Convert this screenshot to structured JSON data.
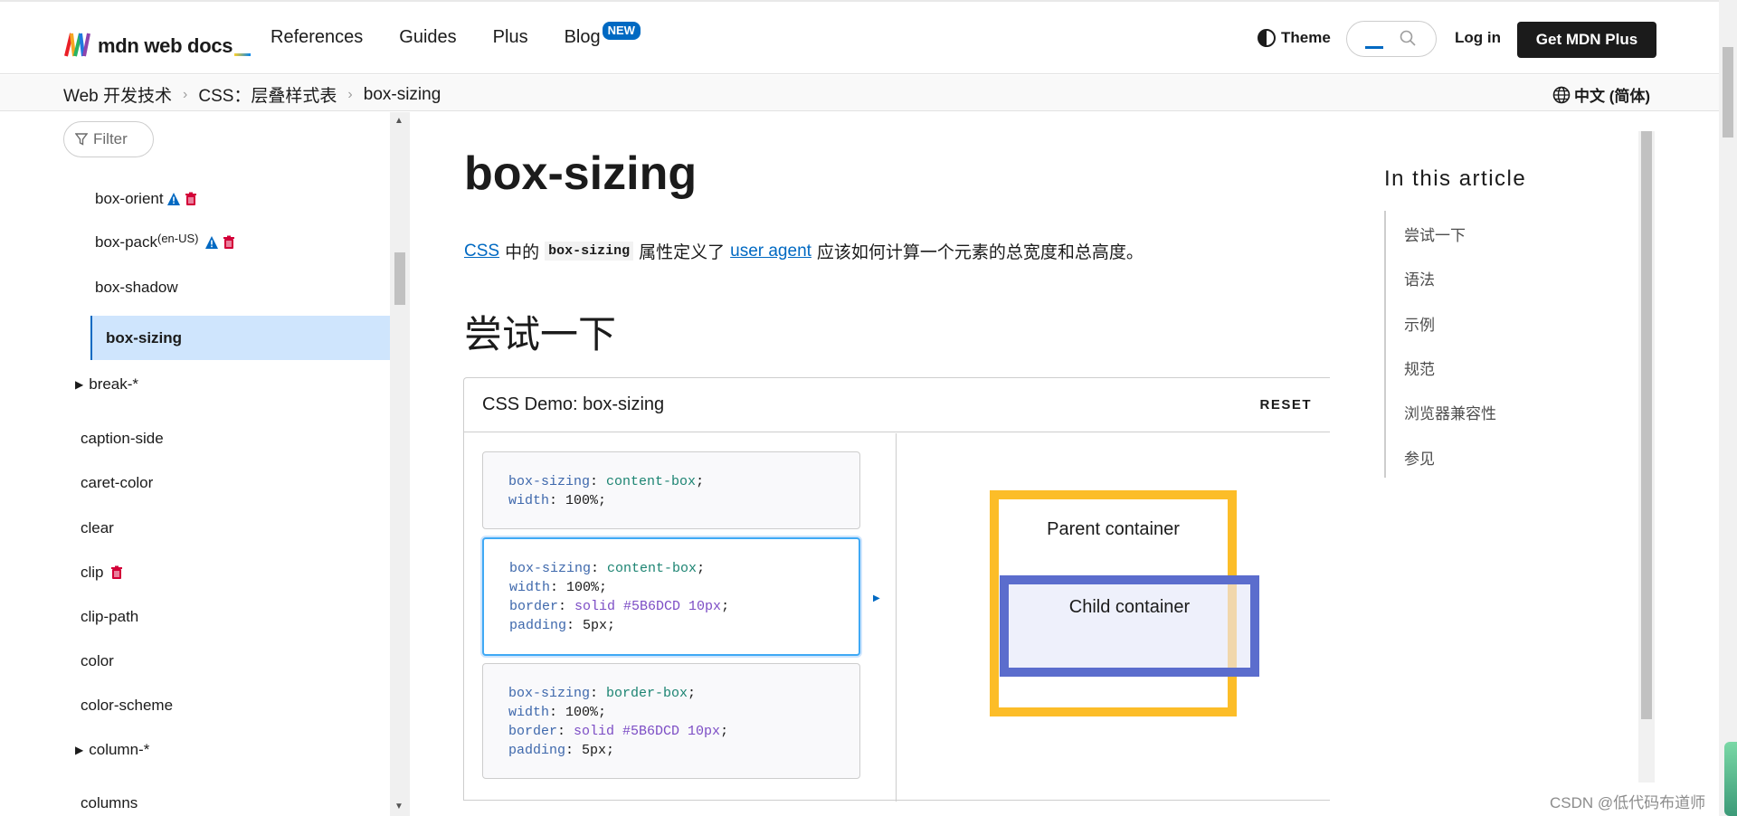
{
  "header": {
    "logo_text": "mdn web docs",
    "nav": [
      {
        "label": "References"
      },
      {
        "label": "Guides"
      },
      {
        "label": "Plus"
      },
      {
        "label": "Blog",
        "badge": "NEW"
      }
    ],
    "theme_label": "Theme",
    "login_label": "Log in",
    "plus_button": "Get MDN Plus"
  },
  "breadcrumb": {
    "items": [
      "Web 开发技术",
      "CSS：层叠样式表",
      "box-sizing"
    ],
    "separator": "›",
    "language": "中文 (简体)"
  },
  "sidebar": {
    "filter_label": "Filter",
    "items": [
      {
        "label": "box-orient",
        "icons": [
          "warning-icon",
          "trash-icon"
        ]
      },
      {
        "label": "box-pack",
        "superscript": "(en-US)",
        "icons": [
          "warning-icon",
          "trash-icon"
        ]
      },
      {
        "label": "box-shadow"
      },
      {
        "label": "box-sizing",
        "active": true
      },
      {
        "label": "break-*",
        "expandable": true
      },
      {
        "label": "caption-side"
      },
      {
        "label": "caret-color"
      },
      {
        "label": "clear"
      },
      {
        "label": "clip",
        "icons": [
          "trash-icon"
        ]
      },
      {
        "label": "clip-path"
      },
      {
        "label": "color"
      },
      {
        "label": "color-scheme"
      },
      {
        "label": "column-*",
        "expandable": true
      },
      {
        "label": "columns"
      }
    ]
  },
  "article": {
    "title": "box-sizing",
    "lead": {
      "link_css": "CSS",
      "text1": "中的",
      "code": "box-sizing",
      "text2": "属性定义了",
      "link_ua": "user agent",
      "text3": "应该如何计算一个元素的总宽度和总高度。"
    },
    "section_heading": "尝试一下"
  },
  "demo": {
    "title": "CSS Demo: box-sizing",
    "reset_label": "RESET",
    "examples": [
      {
        "lines": [
          {
            "prop": "box-sizing",
            "value": "content-box"
          },
          {
            "prop": "width",
            "value": "100%"
          }
        ]
      },
      {
        "selected": true,
        "lines": [
          {
            "prop": "box-sizing",
            "value": "content-box"
          },
          {
            "prop": "width",
            "value": "100%"
          },
          {
            "prop": "border",
            "value": "solid #5B6DCD 10px"
          },
          {
            "prop": "padding",
            "value": "5px"
          }
        ]
      },
      {
        "lines": [
          {
            "prop": "box-sizing",
            "value": "border-box"
          },
          {
            "prop": "width",
            "value": "100%"
          },
          {
            "prop": "border",
            "value": "solid #5B6DCD 10px"
          },
          {
            "prop": "padding",
            "value": "5px"
          }
        ]
      }
    ],
    "parent_label": "Parent container",
    "child_label": "Child container",
    "colors": {
      "parent_border": "#fcbd28",
      "child_border": "#5b6dcd"
    }
  },
  "toc": {
    "title": "In this article",
    "items": [
      "尝试一下",
      "语法",
      "示例",
      "规范",
      "浏览器兼容性",
      "参见"
    ]
  },
  "watermark": "CSDN @低代码布道师"
}
